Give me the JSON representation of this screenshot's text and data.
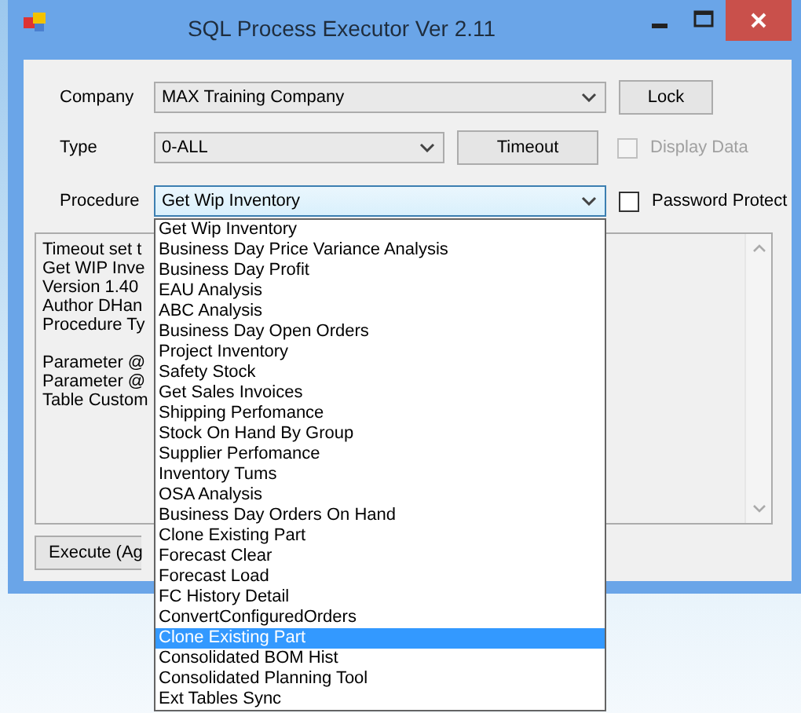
{
  "window": {
    "title": "SQL Process Executor Ver 2.11"
  },
  "company": {
    "label": "Company",
    "value": "MAX Training Company"
  },
  "lock_button": "Lock",
  "type": {
    "label": "Type",
    "value": "0-ALL"
  },
  "timeout_button": "Timeout",
  "display_data": {
    "label": "Display Data",
    "checked": false,
    "disabled": true
  },
  "procedure": {
    "label": "Procedure",
    "value": "Get Wip Inventory",
    "focused": true
  },
  "password_protect": {
    "label": "Password Protect",
    "checked": false,
    "disabled": false
  },
  "output": {
    "paragraphs": [
      [
        "Timeout set t",
        "Get WIP Inve",
        "Version 1.40",
        "Author DHan",
        "Procedure Ty"
      ],
      [
        "Parameter @",
        "Parameter @",
        "Table Custom"
      ]
    ]
  },
  "execute_button": "Execute (Ag",
  "procedure_list": [
    {
      "label": "Get Wip Inventory",
      "selected": false
    },
    {
      "label": "Business Day Price Variance Analysis",
      "selected": false
    },
    {
      "label": "Business Day Profit",
      "selected": false
    },
    {
      "label": "EAU Analysis",
      "selected": false
    },
    {
      "label": "ABC Analysis",
      "selected": false
    },
    {
      "label": "Business Day Open Orders",
      "selected": false
    },
    {
      "label": "Project Inventory",
      "selected": false
    },
    {
      "label": "Safety Stock",
      "selected": false
    },
    {
      "label": "Get Sales Invoices",
      "selected": false
    },
    {
      "label": "Shipping Perfomance",
      "selected": false
    },
    {
      "label": "Stock On Hand By Group",
      "selected": false
    },
    {
      "label": "Supplier Perfomance",
      "selected": false
    },
    {
      "label": "Inventory Tums",
      "selected": false
    },
    {
      "label": "OSA Analysis",
      "selected": false
    },
    {
      "label": "Business Day Orders On Hand",
      "selected": false
    },
    {
      "label": "Clone Existing Part",
      "selected": false
    },
    {
      "label": "Forecast Clear",
      "selected": false
    },
    {
      "label": "Forecast Load",
      "selected": false
    },
    {
      "label": "FC History Detail",
      "selected": false
    },
    {
      "label": "ConvertConfiguredOrders",
      "selected": false
    },
    {
      "label": "Clone Existing Part",
      "selected": true
    },
    {
      "label": "Consolidated BOM Hist",
      "selected": false
    },
    {
      "label": "Consolidated Planning Tool",
      "selected": false
    },
    {
      "label": "Ext Tables Sync",
      "selected": false
    }
  ]
}
